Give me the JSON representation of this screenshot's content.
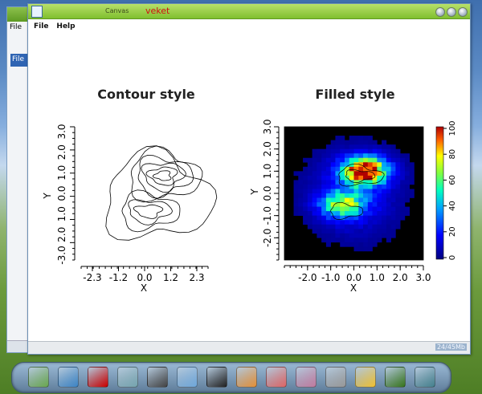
{
  "back_window": {
    "menu_label": "File",
    "strip_label": "File"
  },
  "window": {
    "title": "Canvas",
    "user": "veket",
    "menu": [
      {
        "label": "File"
      },
      {
        "label": "Help"
      }
    ],
    "status": "24/45Mb"
  },
  "taskbar_icons": [
    "pen-icon",
    "monitor-icon",
    "game-icon",
    "notes-icon",
    "media-player-icon",
    "users-icon",
    "penguin-icon",
    "file-manager-icon",
    "image-viewer-icon",
    "paint-icon",
    "brush-icon",
    "photo-icon",
    "image-editor-icon",
    "media-icon"
  ],
  "chart_data": [
    {
      "type": "contour",
      "title": "Contour style",
      "xlabel": "X",
      "ylabel": "Y",
      "x_ticks": [
        "-2.3",
        "-1.2",
        "0.0",
        "1.2",
        "2.3"
      ],
      "y_ticks": [
        "-3.0",
        "2.0",
        "1.0",
        "0.0",
        "1.0",
        "2.0",
        "3.0"
      ],
      "xlim": [
        -3,
        3
      ],
      "ylim": [
        -3,
        3
      ]
    },
    {
      "type": "heatmap",
      "title": "Filled style",
      "xlabel": "X",
      "ylabel": "Y",
      "x_ticks": [
        "-2.0",
        "-1.0",
        "0.0",
        "1.0",
        "2.0",
        "3.0"
      ],
      "y_ticks": [
        "-2.0",
        "-1.0",
        "0.0",
        "1.0",
        "2.0",
        "3.0"
      ],
      "colorbar_ticks": [
        "0",
        "20",
        "40",
        "60",
        "80",
        "100"
      ],
      "xlim": [
        -3,
        3
      ],
      "ylim": [
        -3,
        3
      ],
      "zlim": [
        0,
        100
      ],
      "peaks": [
        {
          "x": 0.5,
          "y": 1.0,
          "amplitude": 100
        },
        {
          "x": -0.5,
          "y": -0.5,
          "amplitude": 55
        }
      ]
    }
  ],
  "colors": {
    "titlebar": "#8fc73e",
    "heat_low": "#0000cc",
    "heat_high": "#b40000"
  }
}
